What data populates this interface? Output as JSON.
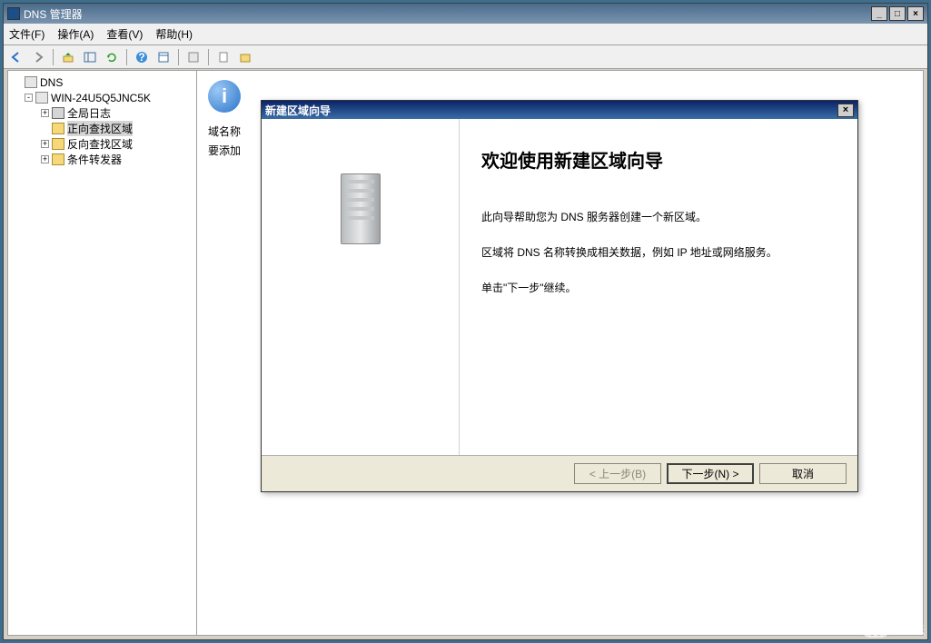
{
  "window": {
    "title": "DNS 管理器"
  },
  "menu": {
    "file": "文件(F)",
    "action": "操作(A)",
    "view": "查看(V)",
    "help": "帮助(H)"
  },
  "tree": {
    "root": "DNS",
    "server": "WIN-24U5Q5JNC5K",
    "global_log": "全局日志",
    "forward": "正向查找区域",
    "reverse": "反向查找区域",
    "conditional": "条件转发器"
  },
  "pane": {
    "label1": "域名称",
    "label2": "要添加"
  },
  "wizard": {
    "title": "新建区域向导",
    "heading": "欢迎使用新建区域向导",
    "para1": "此向导帮助您为 DNS 服务器创建一个新区域。",
    "para2": "区域将 DNS 名称转换成相关数据，例如 IP 地址或网络服务。",
    "para3": "单击\"下一步\"继续。",
    "back": "< 上一步(B)",
    "next": "下一步(N) >",
    "cancel": "取消"
  },
  "watermark": "亿速云"
}
